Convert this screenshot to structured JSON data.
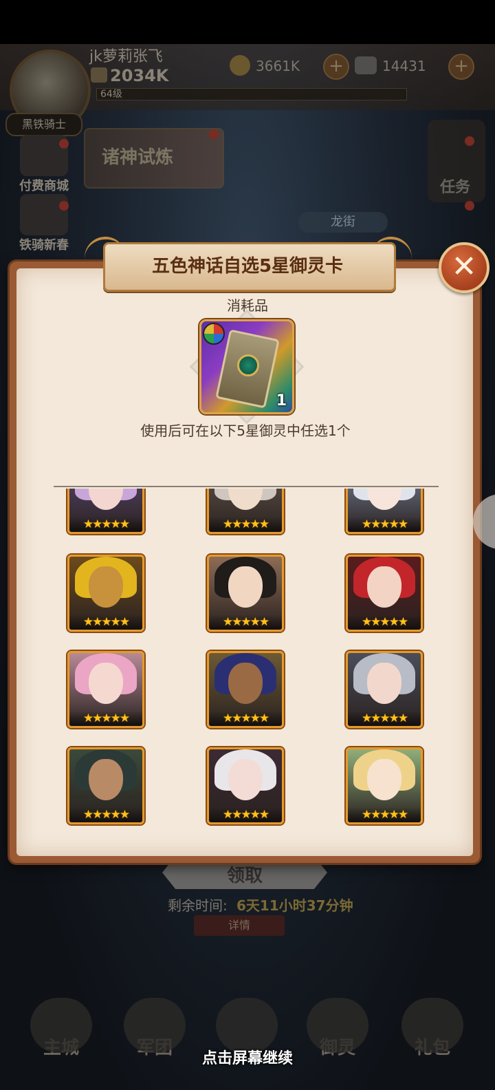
{
  "player": {
    "name": "jk萝莉张飞",
    "power": "2034K",
    "level": "64级",
    "title_badge": "黑铁骑士"
  },
  "resources": {
    "gold": "3661K",
    "gems": "14431",
    "plus": "+"
  },
  "side_menu": {
    "left": [
      "付费商城",
      "铁骑新春"
    ],
    "right": [
      "任务"
    ]
  },
  "event_banner": "诸神试炼",
  "location_button": "龙街",
  "modal": {
    "title": "五色神话自选5星御灵卡",
    "close_symbol": "✕",
    "item_type": "消耗品",
    "item_quantity": "1",
    "description": "使用后可在以下5星御灵中任选1个",
    "star_glyphs": "★★★★★",
    "heroes": [
      {
        "id": "hero-1",
        "hair": "#c9a6d9",
        "skin": "#f2d6cf",
        "bg": "#5e4a78"
      },
      {
        "id": "hero-2",
        "hair": "#cfc7bf",
        "skin": "#f0dccb",
        "bg": "#6a5b4e"
      },
      {
        "id": "hero-3",
        "hair": "#dfe3ec",
        "skin": "#f7e5dc",
        "bg": "#7e8aa5"
      },
      {
        "id": "hero-4",
        "hair": "#e2b51f",
        "skin": "#c8913c",
        "bg": "#6c4a1c"
      },
      {
        "id": "hero-5",
        "hair": "#1f1c1a",
        "skin": "#f1d7c2",
        "bg": "#8d6c55"
      },
      {
        "id": "hero-6",
        "hair": "#c2262a",
        "skin": "#f3d3c4",
        "bg": "#5a1c1e"
      },
      {
        "id": "hero-7",
        "hair": "#eaa6c4",
        "skin": "#f5d8d0",
        "bg": "#b78a96"
      },
      {
        "id": "hero-8",
        "hair": "#2a2f74",
        "skin": "#9a6a45",
        "bg": "#6d5a34"
      },
      {
        "id": "hero-9",
        "hair": "#b7bcc6",
        "skin": "#f2d8cc",
        "bg": "#4b4e5a"
      },
      {
        "id": "hero-10",
        "hair": "#2b3a36",
        "skin": "#b98a66",
        "bg": "#3b4a3a"
      },
      {
        "id": "hero-11",
        "hair": "#e9e6ea",
        "skin": "#f4dcd6",
        "bg": "#3c2a34"
      },
      {
        "id": "hero-12",
        "hair": "#efd28a",
        "skin": "#f7e2cf",
        "bg": "#8fae7a"
      }
    ]
  },
  "background_panel": {
    "claim_button": "领取",
    "remaining_label": "剩余时间:",
    "remaining_value": "6天11小时37分钟",
    "details_button": "详情"
  },
  "bottom_nav": [
    "主城",
    "军团",
    "",
    "御灵",
    "礼包"
  ],
  "tap_to_continue": "点击屏幕继续"
}
